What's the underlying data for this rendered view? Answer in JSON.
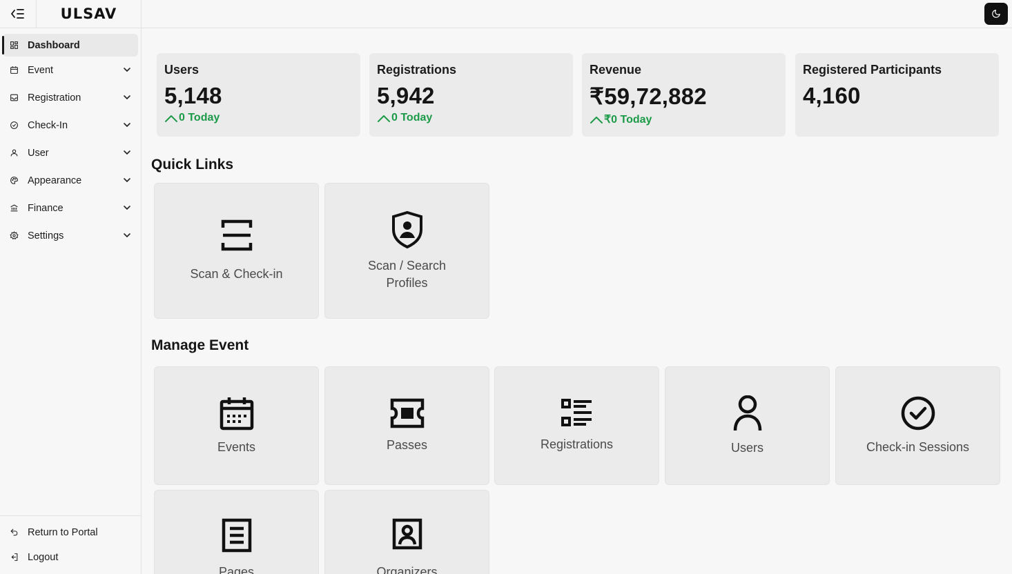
{
  "header": {
    "logo": "ULSAV"
  },
  "sidebar": {
    "items": [
      {
        "label": "Dashboard",
        "icon": "grid-icon"
      },
      {
        "label": "Event",
        "icon": "calendar-icon"
      },
      {
        "label": "Registration",
        "icon": "inbox-icon"
      },
      {
        "label": "Check-In",
        "icon": "check-circle-icon"
      },
      {
        "label": "User",
        "icon": "user-icon"
      },
      {
        "label": "Appearance",
        "icon": "palette-icon"
      },
      {
        "label": "Finance",
        "icon": "bank-icon"
      },
      {
        "label": "Settings",
        "icon": "gear-icon"
      }
    ],
    "footer": [
      {
        "label": "Return to Portal",
        "icon": "undo-icon"
      },
      {
        "label": "Logout",
        "icon": "logout-icon"
      }
    ]
  },
  "stats": [
    {
      "title": "Users",
      "value": "5,148",
      "today": "0 Today"
    },
    {
      "title": "Registrations",
      "value": "5,942",
      "today": "0 Today"
    },
    {
      "title": "Revenue",
      "value": "₹59,72,882",
      "today": "₹0 Today"
    },
    {
      "title": "Registered Participants",
      "value": "4,160"
    }
  ],
  "quick_links": {
    "title": "Quick Links",
    "items": [
      {
        "label": "Scan & Check-in",
        "icon": "scan-icon"
      },
      {
        "label": "Scan / Search Profiles",
        "icon": "shield-user-icon"
      }
    ]
  },
  "manage_event": {
    "title": "Manage Event",
    "items": [
      {
        "label": "Events",
        "icon": "calendar-icon"
      },
      {
        "label": "Passes",
        "icon": "ticket-icon"
      },
      {
        "label": "Registrations",
        "icon": "list-icon"
      },
      {
        "label": "Users",
        "icon": "user-icon"
      },
      {
        "label": "Check-in Sessions",
        "icon": "check-circle-icon"
      },
      {
        "label": "Pages",
        "icon": "document-icon"
      },
      {
        "label": "Organizers",
        "icon": "contact-icon"
      }
    ]
  },
  "colors": {
    "accent_green": "#1b9a48",
    "tile_bg": "#ebebeb",
    "page_bg": "#f7f7f7"
  }
}
